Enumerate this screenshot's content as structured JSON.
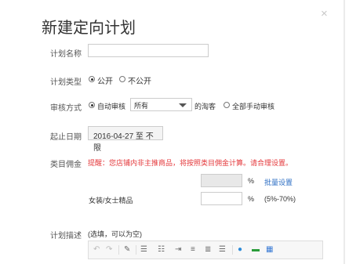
{
  "dialog": {
    "title": "新建定向计划",
    "close_icon": "×"
  },
  "form": {
    "plan_name": {
      "label": "计划名称",
      "value": "",
      "placeholder": ""
    },
    "plan_type": {
      "label": "计划类型",
      "options": [
        {
          "label": "公开",
          "selected": true
        },
        {
          "label": "不公开",
          "selected": false
        }
      ]
    },
    "review": {
      "label": "审核方式",
      "auto_label": "自动审核",
      "auto_selected": true,
      "select_value": "所有",
      "suffix": "的淘客",
      "manual_label": "全部手动审核",
      "manual_selected": false
    },
    "dates": {
      "label": "起止日期",
      "value": "2016-04-27 至 不限"
    },
    "category_commission": {
      "label": "类目佣金",
      "warning": "提醒：您店铺内非主推商品，将按照类目佣金计算。请合理设置。",
      "batch_unit": "%",
      "batch_link": "批量设置",
      "category_name": "女装/女士精品",
      "category_unit": "%",
      "category_range": "(5%-70%)"
    },
    "description": {
      "label": "计划描述",
      "hint": "(选填，可以为空)"
    }
  },
  "toolbar": {
    "undo": "↶",
    "redo": "↷",
    "clear": "✎",
    "ul": "☰",
    "ol": "☷",
    "indent": "⇥",
    "align_left": "≡",
    "align_center": "≣",
    "align_right": "☰",
    "link": "●",
    "image": "▬",
    "table": "▦"
  }
}
